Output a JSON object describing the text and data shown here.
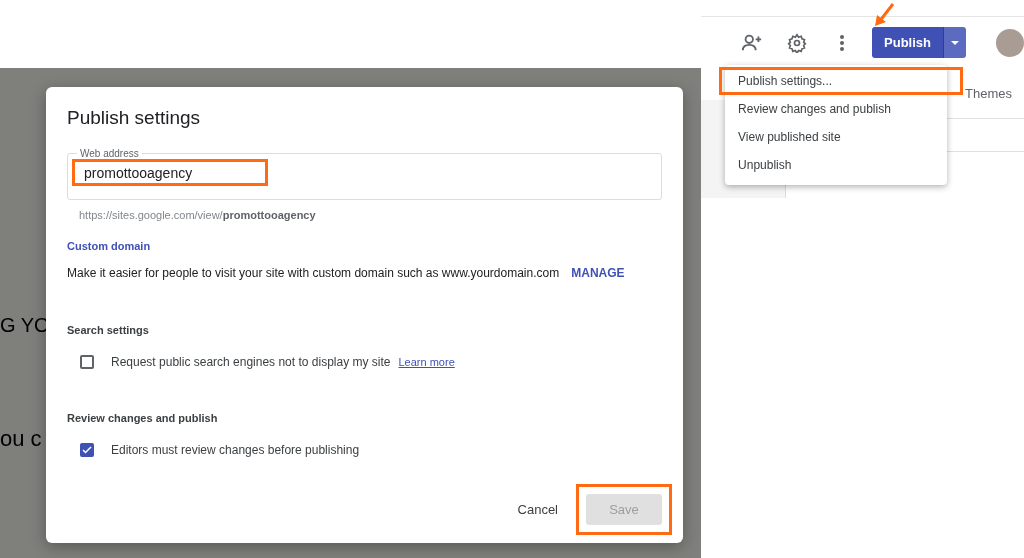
{
  "backdrop": {
    "fragments": [
      "G YO",
      "ou c"
    ]
  },
  "toolbar": {
    "publish_button": "Publish",
    "pointer_arrow": true
  },
  "publish_menu": {
    "items": [
      {
        "label": "Publish settings...",
        "highlighted": true
      },
      {
        "label": "Review changes and publish",
        "highlighted": false
      },
      {
        "label": "View published site",
        "highlighted": false
      },
      {
        "label": "Unpublish",
        "highlighted": false
      }
    ]
  },
  "side_panel": {
    "tab": "Themes"
  },
  "dialog": {
    "title": "Publish settings",
    "web_address": {
      "label": "Web address",
      "value": "promottooagency",
      "highlighted": true
    },
    "url_hint": "https://sites.google.com/view/**promottooagency**",
    "custom_domain": {
      "heading": "Custom domain",
      "text": "Make it easier for people to visit your site with custom domain such as www.yourdomain.com",
      "action": "MANAGE"
    },
    "sections": [
      {
        "heading": "Search settings",
        "label": "Request public search engines not to display my site",
        "link": "Learn more",
        "checked": false
      },
      {
        "heading": "Review changes and publish",
        "label": "Editors must review changes before publishing",
        "checked": true
      }
    ],
    "buttons": {
      "cancel": "Cancel",
      "save": "Save",
      "save_disabled": true,
      "save_highlighted": true
    }
  }
}
